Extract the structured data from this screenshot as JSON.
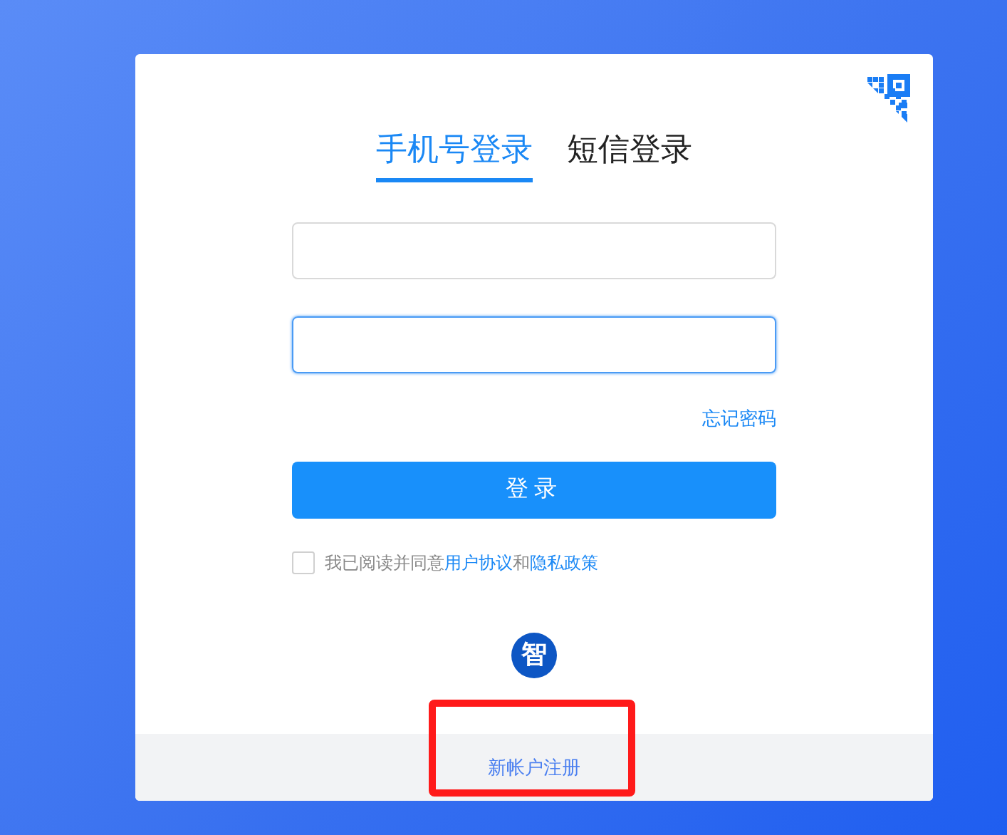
{
  "tabs": [
    {
      "label": "手机号登录",
      "selected": true
    },
    {
      "label": "短信登录",
      "selected": false
    }
  ],
  "fields": [
    {
      "focused": false
    },
    {
      "focused": true
    }
  ],
  "forgot_link": "忘记密码",
  "login_button": "登录",
  "agreement": {
    "checked": false,
    "text": "我已阅读并同意",
    "link1": "用户协议",
    "joiner": "和",
    "link2": "隐私政策"
  },
  "logo": "智",
  "register_link": "新帐户注册",
  "annotation": {
    "highlight": true
  }
}
